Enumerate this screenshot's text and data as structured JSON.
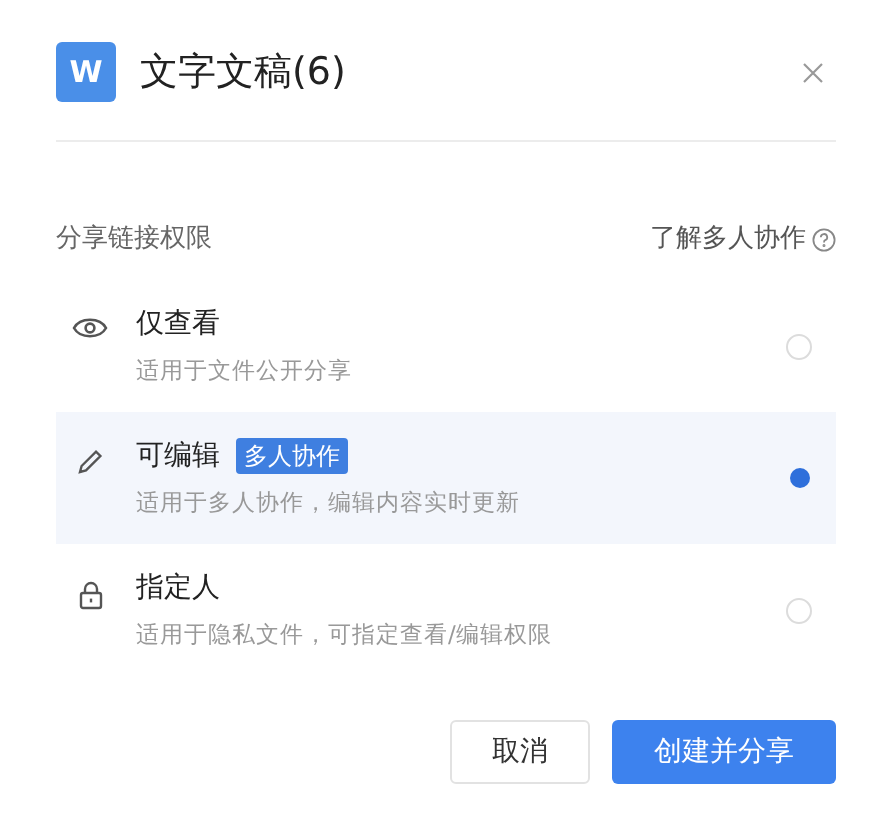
{
  "dialog": {
    "logo": "W",
    "title": "文字文稿(6)"
  },
  "section": {
    "label": "分享链接权限",
    "help_link": "了解多人协作"
  },
  "options": [
    {
      "kind": "view",
      "title": "仅查看",
      "description": "适用于文件公开分享",
      "selected": false
    },
    {
      "kind": "edit",
      "title": "可编辑",
      "badge": "多人协作",
      "description": "适用于多人协作，编辑内容实时更新",
      "selected": true
    },
    {
      "kind": "restricted",
      "title": "指定人",
      "description": "适用于隐私文件，可指定查看/编辑权限",
      "selected": false
    }
  ],
  "buttons": [
    {
      "kind": "secondary",
      "label": "取消"
    },
    {
      "kind": "primary",
      "label": "创建并分享"
    }
  ]
}
